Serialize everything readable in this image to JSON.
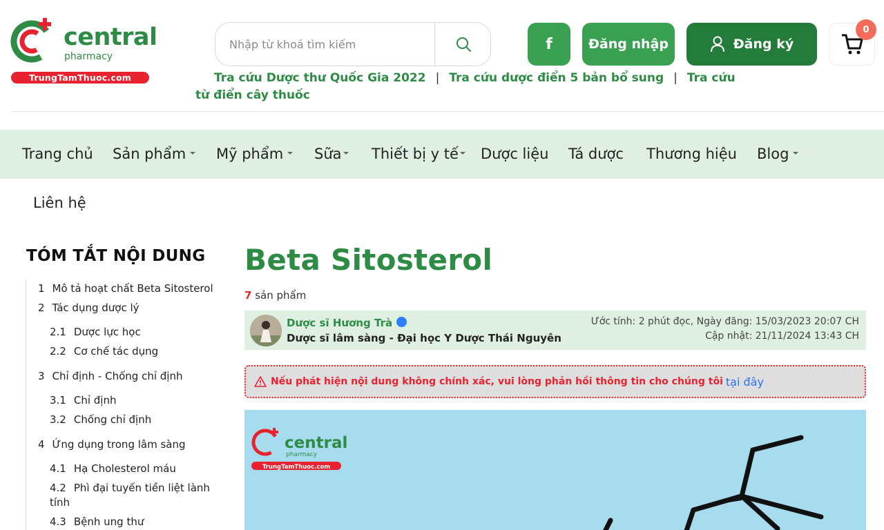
{
  "brand": {
    "name": "central",
    "sub": "pharmacy",
    "domain": "TrungTamThuoc.com",
    "green": "#2e8b45",
    "red": "#e8222f"
  },
  "header": {
    "search_placeholder": "Nhập từ khoá tìm kiếm",
    "facebook_label": "f",
    "login_label": "Đăng nhập",
    "register_label": "Đăng ký",
    "cart_count": "0",
    "quick_links": [
      {
        "label": "Tra cứu Dược thư Quốc Gia 2022"
      },
      {
        "label": "Tra cứu dược điển 5 bản bổ sung"
      },
      {
        "label": "Tra cứu"
      },
      {
        "label": "từ điển cây thuốc"
      }
    ],
    "separator": "|"
  },
  "nav": {
    "items": [
      {
        "label": "Trang chủ"
      },
      {
        "label": "Sản phẩm"
      },
      {
        "label": "Mỹ phẩm"
      },
      {
        "label": "Sữa"
      },
      {
        "label": "Thiết bị y tế"
      },
      {
        "label": "Dược liệu"
      },
      {
        "label": "Tá dược"
      },
      {
        "label": "Thương hiệu"
      },
      {
        "label": "Blog"
      }
    ],
    "contact_label": "Liên hệ"
  },
  "toc": {
    "title": "TÓM TẮT NỘI DUNG",
    "items": [
      {
        "num": "1",
        "label": "Mô tả hoạt chất Beta Sitosterol"
      },
      {
        "num": "2",
        "label": "Tác dụng dược lý"
      },
      {
        "num": "2.1",
        "label": "Dược lực học"
      },
      {
        "num": "2.2",
        "label": "Cơ chế tác dụng"
      },
      {
        "num": "3",
        "label": "Chỉ định - Chống chỉ định"
      },
      {
        "num": "3.1",
        "label": "Chỉ định"
      },
      {
        "num": "3.2",
        "label": "Chống chỉ định"
      },
      {
        "num": "4",
        "label": "Ứng dụng trong lâm sàng"
      },
      {
        "num": "4.1",
        "label": "Hạ Cholesterol máu"
      },
      {
        "num": "4.2",
        "label": "Phì đại tuyến tiền liệt lành"
      },
      {
        "num": "",
        "label": "tính"
      },
      {
        "num": "4.3",
        "label": "Bệnh ung thư"
      }
    ]
  },
  "article": {
    "title": "Beta Sitosterol",
    "product_count": "7",
    "product_suffix": "sản phẩm",
    "author_name": "Dược sĩ Hương Trà",
    "author_role": "Dược sĩ lâm sàng - Đại học Y Dược Thái Nguyên",
    "meta_read": "Ước tính: 2 phút đọc, Ngày đăng: 15/03/2023 20:07 CH",
    "meta_update": "Cập nhật: 21/11/2024 13:43 CH",
    "warning_text": "Nếu phát hiện nội dung không chính xác, vui lòng phản hồi thông tin cho chúng tôi",
    "warning_link": "tại đây"
  },
  "hero": {
    "logo_name": "central",
    "logo_sub": "pharmacy",
    "logo_domain": "TrungTamThuoc.com",
    "background": "#a7dcef"
  }
}
